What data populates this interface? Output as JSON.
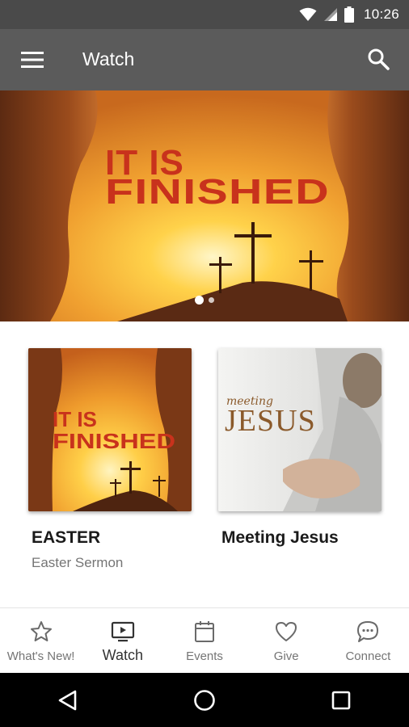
{
  "status_bar": {
    "time": "10:26"
  },
  "app_bar": {
    "title": "Watch"
  },
  "hero": {
    "title_line1": "IT IS",
    "title_line2": "FINISHED",
    "active_slide": 1,
    "slide_count": 2
  },
  "cards": [
    {
      "art_line1": "IT IS",
      "art_line2": "FINISHED",
      "title": "EASTER",
      "subtitle": "Easter Sermon"
    },
    {
      "art_small": "meeting",
      "art_big": "JESUS",
      "title": "Meeting Jesus",
      "subtitle": ""
    }
  ],
  "bottom_nav": {
    "items": [
      {
        "label": "What's New!",
        "icon": "star-icon"
      },
      {
        "label": "Watch",
        "icon": "tv-icon"
      },
      {
        "label": "Events",
        "icon": "calendar-icon"
      },
      {
        "label": "Give",
        "icon": "heart-icon"
      },
      {
        "label": "Connect",
        "icon": "chat-icon"
      }
    ],
    "active": "Watch"
  },
  "colors": {
    "status_bar": "#4a4a4a",
    "app_bar": "#5b5b5b",
    "title_red": "#c8321c"
  }
}
